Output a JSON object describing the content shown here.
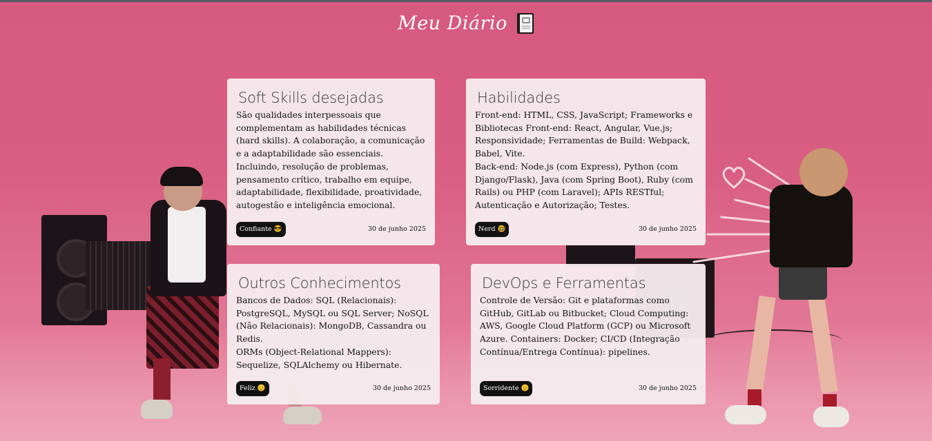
{
  "header": {
    "title": "Meu Diário",
    "icon": "notebook-icon"
  },
  "cards": [
    {
      "title": "Soft Skills desejadas",
      "body": "São qualidades interpessoais que complementam as habilidades técnicas (hard skills). A colaboração, a comunicação e a adaptabilidade são essenciais.\nIncluindo, resolução de problemas, pensamento crítico, trabalho em equipe, adaptabilidade, flexibilidade, proatividade, autogestão e inteligência emocional.",
      "mood": "Confiante 😎",
      "date": "30 de junho 2025"
    },
    {
      "title": "Habilidades",
      "body": "Front-end: HTML, CSS, JavaScript; Frameworks e Bibliotecas Front-end: React, Angular, Vue.js; Responsividade; Ferramentas de Build: Webpack, Babel, Vite.\nBack-end: Node.js (com Express), Python (com Django/Flask), Java (com Spring Boot), Ruby (com Rails) ou PHP (com Laravel); APIs RESTful; Autenticação e Autorização; Testes.",
      "mood": "Nerd 🤓",
      "date": "30 de junho 2025"
    },
    {
      "title": "Outros Conhecimentos",
      "body": "Bancos de Dados: SQL (Relacionais): PostgreSQL, MySQL ou SQL Server; NoSQL (Não Relacionais): MongoDB, Cassandra ou Redis.\nORMs (Object-Relational Mappers): Sequelize, SQLAlchemy ou Hibernate.",
      "mood": "Feliz 😊",
      "date": "30 de junho 2025"
    },
    {
      "title": "DevOps e Ferramentas",
      "body": "Controle de Versão: Git e plataformas como GitHub, GitLab ou Bitbucket; Cloud Computing: AWS, Google Cloud Platform (GCP) ou Microsoft Azure. Containers: Docker; CI/CD (Integração Contínua/Entrega Contínua): pipelines.",
      "mood": "Sorridente 😊",
      "date": "30 de junho 2025"
    }
  ],
  "colors": {
    "background": "#d95f82",
    "card": "#f5ebee",
    "badge": "#111111"
  }
}
